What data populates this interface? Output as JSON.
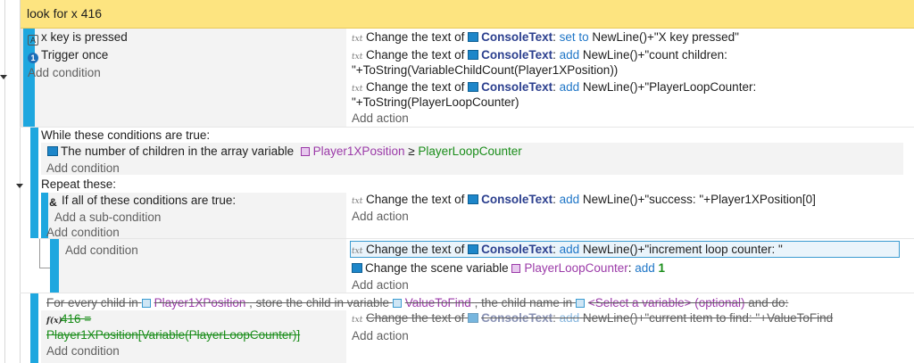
{
  "comment_bar": {
    "text": "look for x 416",
    "color": "#fde480"
  },
  "event1": {
    "conditions": [
      {
        "icon": "key-icon",
        "text": "x key is pressed"
      },
      {
        "icon": "trigger-once-icon",
        "text": "Trigger once"
      }
    ],
    "add_condition": "Add condition",
    "actions": [
      {
        "prefix": "Change the text of",
        "object": "ConsoleText",
        "op": "set to",
        "value": "NewLine()+\"X key pressed\""
      },
      {
        "prefix": "Change the text of",
        "object": "ConsoleText",
        "op": "add",
        "value": "NewLine()+\"count children:",
        "value2": "\"+ToString(VariableChildCount(Player1XPosition))"
      },
      {
        "prefix": "Change the text of",
        "object": "ConsoleText",
        "op": "add",
        "value": "NewLine()+\"PlayerLoopCounter:",
        "value2": "\"+ToString(PlayerLoopCounter)"
      }
    ],
    "add_action": "Add action"
  },
  "while_event": {
    "header": "While these conditions are true:",
    "condition": {
      "text": "The number of children in the array variable",
      "variable": "Player1XPosition",
      "op": "≥",
      "value": "PlayerLoopCounter"
    },
    "add_condition": "Add condition",
    "repeat": "Repeat these:",
    "sub1": {
      "condition": "If all of these conditions are true:",
      "add_sub_condition": "Add a sub-condition",
      "add_condition": "Add condition",
      "action": {
        "prefix": "Change the text of",
        "object": "ConsoleText",
        "op": "add",
        "value": "NewLine()+\"success: \"+Player1XPosition[0]"
      },
      "add_action": "Add action"
    },
    "sub2": {
      "add_condition": "Add condition",
      "actions": [
        {
          "prefix": "Change the text of",
          "object": "ConsoleText",
          "op": "add",
          "value": "NewLine()+\"increment loop counter: \""
        },
        {
          "prefix": "Change the scene variable",
          "variable": "PlayerLoopCounter",
          "op": "add",
          "value": "1"
        }
      ],
      "add_action": "Add action"
    }
  },
  "foreach_event": {
    "header_prefix": "For every child in",
    "header_var": "Player1XPosition",
    "header_mid": ", store the child in variable",
    "header_var2": "ValueToFind",
    "header_mid2": ", the child name in",
    "header_var3": "<Select a variable> (optional)",
    "header_suffix": "and do:",
    "condition_line1": "416 =",
    "condition_line2": "Player1XPosition[Variable(PlayerLoopCounter)]",
    "add_condition": "Add condition",
    "action": {
      "prefix": "Change the text of",
      "object": "ConsoleText",
      "op": "add",
      "value": "NewLine()+\"current item to find: \"+ValueToFind"
    },
    "add_action": "Add action"
  }
}
